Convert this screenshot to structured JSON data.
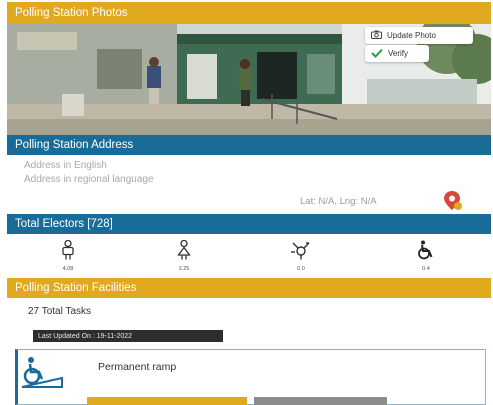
{
  "sections": {
    "photos": "Polling Station Photos",
    "address": "Polling Station Address",
    "electors": "Total Electors [728]",
    "facilities": "Polling Station Facilities"
  },
  "photo_actions": {
    "update": "Update Photo",
    "verify": "Verify"
  },
  "address": {
    "english": "Address in English",
    "regional": "Address in regional language",
    "latlng": "Lat: N/A, Lng: N/A"
  },
  "elector_categories": [
    {
      "icon": "male-voter-icon",
      "label": "4.08"
    },
    {
      "icon": "female-voter-icon",
      "label": "3.25"
    },
    {
      "icon": "gender-other-icon",
      "label": "0.0"
    },
    {
      "icon": "wheelchair-icon",
      "label": "0.4"
    }
  ],
  "facilities": {
    "total_tasks": "27 Total Tasks",
    "last_updated": "Last Updated On : 19-11-2022",
    "items": [
      {
        "icon": "ramp-wheelchair-icon",
        "name": "Permanent ramp"
      }
    ]
  },
  "colors": {
    "yellow": "#e0a91e",
    "blue": "#1a6c98",
    "gray_button": "#8c8c8c"
  }
}
